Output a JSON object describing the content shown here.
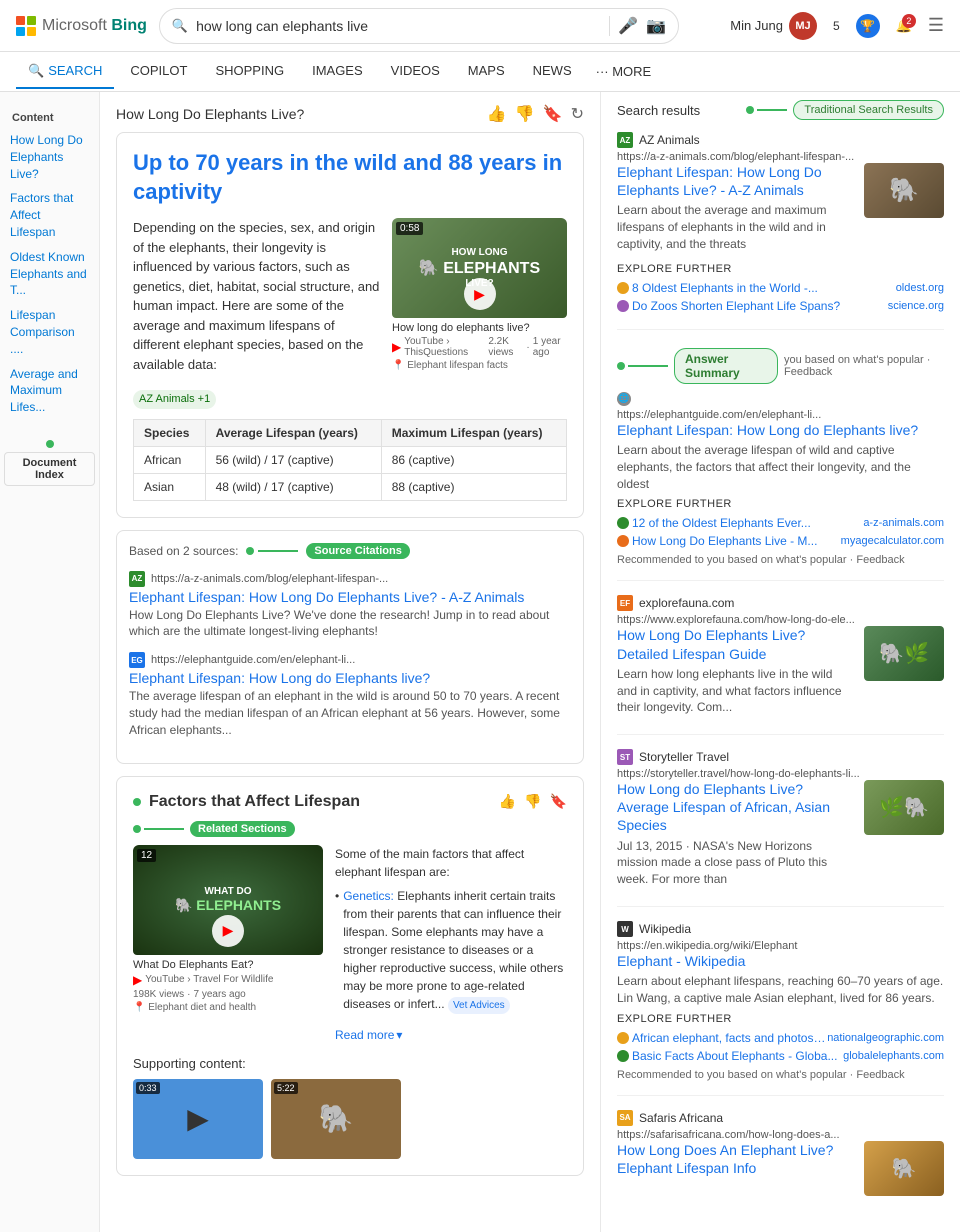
{
  "header": {
    "logo_text": "Microsoft Bing",
    "logo_bing": "Bing",
    "search_query": "how long can elephants live",
    "user_name": "Min Jung",
    "badge_count": "5",
    "notif_count": "2"
  },
  "nav": {
    "tabs": [
      {
        "id": "search",
        "label": "SEARCH",
        "active": true
      },
      {
        "id": "copilot",
        "label": "COPILOT",
        "active": false
      },
      {
        "id": "shopping",
        "label": "SHOPPING",
        "active": false
      },
      {
        "id": "images",
        "label": "IMAGES",
        "active": false
      },
      {
        "id": "videos",
        "label": "VIDEOS",
        "active": false
      },
      {
        "id": "maps",
        "label": "MAPS",
        "active": false
      },
      {
        "id": "news",
        "label": "NEWS",
        "active": false
      }
    ],
    "more_label": "··· MORE"
  },
  "sidebar": {
    "content_label": "Content",
    "items": [
      {
        "label": "How Long Do Elephants Live?",
        "active": true
      },
      {
        "label": "Factors that Affect Lifespan"
      },
      {
        "label": "Oldest Known Elephants and T..."
      },
      {
        "label": "Lifespan Comparison ...."
      },
      {
        "label": "Average and Maximum Lifes..."
      }
    ],
    "doc_index_label": "Document Index"
  },
  "content": {
    "page_title": "How Long Do Elephants Live?",
    "answer_headline": "Up to 70 years in the wild and 88 years in captivity",
    "source_tag": "AZ Animals +1",
    "answer_text": "Depending on the species, sex, and origin of the elephants, their longevity is influenced by various factors, such as genetics, diet, habitat, social structure, and human impact. Here are some of the average and maximum lifespans of different elephant species, based on the available data:",
    "video": {
      "duration": "0:58",
      "title": "How long do elephants live?",
      "channel": "YouTube › ThisQuestions",
      "views": "2.2K views",
      "time_ago": "1 year ago"
    },
    "location_meta": "Elephant lifespan facts",
    "table": {
      "headers": [
        "Species",
        "Average Lifespan (years)",
        "Maximum Lifespan (years)"
      ],
      "rows": [
        [
          "African",
          "56 (wild) / 17 (captive)",
          "86 (captive)"
        ],
        [
          "Asian",
          "48 (wild) / 17 (captive)",
          "88 (captive)"
        ]
      ]
    },
    "table_source_tag": "AZ Animals +1",
    "sources_section": {
      "prefix": "Based on 2 sources:",
      "label": "Source Citations",
      "items": [
        {
          "favicon_type": "az",
          "favicon_label": "AZ",
          "source_name": "AZ Animals",
          "url": "https://a-z-animals.com/blog/elephant-lifespan-...",
          "link_text": "Elephant Lifespan: How Long Do Elephants Live? - A-Z Animals",
          "snippet": "How Long Do Elephants Live? We've done the research! Jump in to read about which are the ultimate longest-living elephants!"
        },
        {
          "favicon_type": "eg",
          "favicon_label": "EG",
          "source_name": "Elephant Guide",
          "url": "https://elephantguide.com/en/elephant-li...",
          "link_text": "Elephant Lifespan: How Long do Elephants live?",
          "snippet": "The average lifespan of an elephant in the wild is around 50 to 70 years. A recent study had the median lifespan of an African elephant at 56 years. However, some African elephants..."
        }
      ]
    },
    "factors_section": {
      "title": "Factors that Affect Lifespan",
      "video": {
        "duration": "12",
        "title": "WHAT DO ELEPHANTS",
        "subtitle": "What Do Elephants Eat?",
        "channel": "YouTube › Travel For Wildlife",
        "views": "198K views",
        "time_ago": "7 years ago"
      },
      "location_meta": "Elephant diet and health",
      "text_intro": "Some of the main factors that affect elephant lifespan are:",
      "bullets": [
        {
          "term": "Genetics:",
          "text": "Elephants inherit certain traits from their parents that can influence their lifespan. Some elephants may have a stronger resistance to diseases or a higher reproductive success, while others may be more prone to age-related diseases or infert..."
        }
      ],
      "vet_tag": "Vet Advices",
      "read_more": "Read more"
    },
    "supporting_label": "Supporting content:",
    "support_videos": [
      {
        "duration": "0:33",
        "bg_color": "#4a90d9"
      },
      {
        "duration": "5:22",
        "bg_color": "#8b6a3e"
      }
    ],
    "related_sections_label": "Related Sections"
  },
  "right_panel": {
    "results_title": "Search results",
    "traditional_badge": "Traditional Search Results",
    "answer_summary_label": "Answer Summary",
    "feedback_text": "you based on what's popular · Feedback",
    "results": [
      {
        "id": "az_animals",
        "favicon_type": "az",
        "favicon_label": "AZ",
        "source_name": "AZ Animals",
        "url": "https://a-z-animals.com/blog/elephant-lifespan-...",
        "title": "Elephant Lifespan: How Long Do Elephants Live? - A-Z Animals",
        "snippet": "Learn about the average and maximum lifespans of elephants in the wild and in captivity, and the threats",
        "has_thumb": true,
        "thumb_type": "elephant",
        "explore_further_label": "EXPLORE FURTHER",
        "explore_links": [
          {
            "icon_color": "#e8a01a",
            "text": "8 Oldest Elephants in the World -...",
            "domain": "oldest.org"
          },
          {
            "icon_color": "#9b59b6",
            "text": "Do Zoos Shorten Elephant Life Spans?",
            "domain": "science.org"
          }
        ]
      },
      {
        "id": "elephant_guide",
        "favicon_type": "globe",
        "favicon_label": "🌐",
        "source_name": "",
        "url": "https://elephantguide.com/en/elephant-li...",
        "title": "Elephant Lifespan: How Long do Elephants live?",
        "snippet": "Learn about the average lifespan of wild and captive elephants, the factors that affect their longevity, and the oldest",
        "has_thumb": false,
        "explore_further_label": "EXPLORE FURTHER",
        "explore_links": [
          {
            "icon_color": "#2d8c2d",
            "text": "12 of the Oldest Elephants Ever...",
            "domain": "a-z-animals.com"
          },
          {
            "icon_color": "#e86c1a",
            "text": "How Long Do Elephants Live - M...",
            "domain": "myagecalculator.com"
          }
        ],
        "recommended_note": "Recommended to you based on what's popular · Feedback"
      },
      {
        "id": "explorefauna",
        "favicon_type": "ef",
        "favicon_label": "EF",
        "source_name": "explorefauna.com",
        "url": "https://www.explorefauna.com/how-long-do-ele...",
        "title": "How Long Do Elephants Live? Detailed Lifespan Guide",
        "snippet": "Learn how long elephants live in the wild and in captivity, and what factors influence their longevity. Com...",
        "has_thumb": true,
        "thumb_type": "elephant2"
      },
      {
        "id": "storyteller",
        "favicon_type": "st",
        "favicon_label": "ST",
        "source_name": "Storyteller Travel",
        "url": "https://storyteller.travel/how-long-do-elephants-li...",
        "title": "How Long do Elephants Live? Average Lifespan of African, Asian Species",
        "snippet": "Jul 13, 2015 · NASA's New Horizons mission made a close pass of Pluto this week. For more than",
        "has_thumb": true,
        "thumb_type": "elephant3"
      },
      {
        "id": "wikipedia",
        "favicon_type": "wiki",
        "favicon_label": "W",
        "source_name": "Wikipedia",
        "url": "https://en.wikipedia.org/wiki/Elephant",
        "title": "Elephant - Wikipedia",
        "snippet": "Learn about elephant lifespans, reaching 60–70 years of age. Lin Wang, a captive male Asian elephant, lived for 86 years.",
        "has_thumb": false,
        "explore_further_label": "EXPLORE FURTHER",
        "explore_links": [
          {
            "icon_color": "#e8a01a",
            "text": "African elephant, facts and photos -...",
            "domain": "nationalgeographic.com"
          },
          {
            "icon_color": "#2d8c2d",
            "text": "Basic Facts About Elephants - Globa...",
            "domain": "globalelephants.com"
          }
        ],
        "recommended_note": "Recommended to you based on what's popular · Feedback"
      },
      {
        "id": "safaris_africana",
        "favicon_type": "sa",
        "favicon_label": "SA",
        "source_name": "Safaris Africana",
        "url": "https://safarisafricana.com/how-long-does-a...",
        "title": "How Long Does An Elephant Live? Elephant Lifespan Info",
        "snippet": "",
        "has_thumb": true,
        "thumb_type": "elephant4"
      }
    ]
  }
}
